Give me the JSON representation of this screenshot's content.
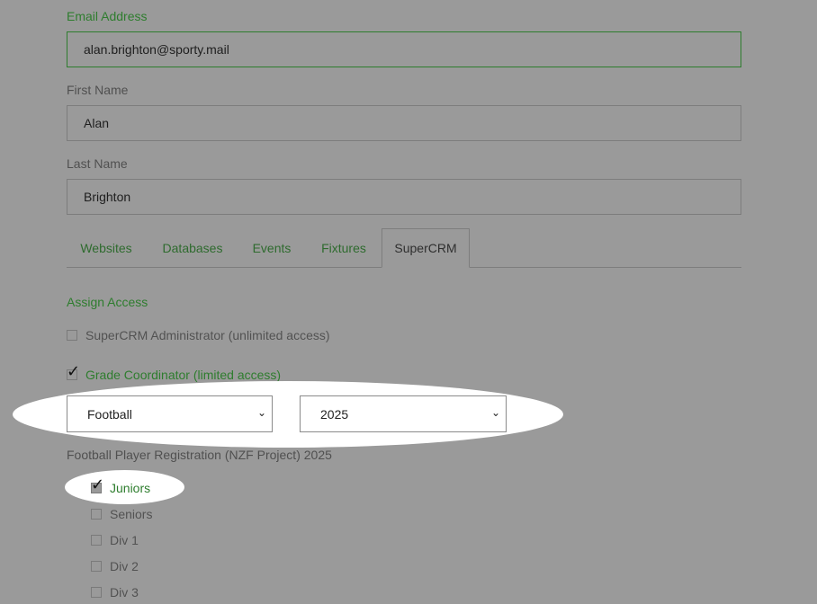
{
  "form": {
    "email": {
      "label": "Email Address",
      "value": "alan.brighton@sporty.mail"
    },
    "first_name": {
      "label": "First Name",
      "value": "Alan"
    },
    "last_name": {
      "label": "Last Name",
      "value": "Brighton"
    }
  },
  "tabs": [
    {
      "label": "Websites",
      "active": false
    },
    {
      "label": "Databases",
      "active": false
    },
    {
      "label": "Events",
      "active": false
    },
    {
      "label": "Fixtures",
      "active": false
    },
    {
      "label": "SuperCRM",
      "active": true
    }
  ],
  "access": {
    "heading": "Assign Access",
    "admin": {
      "label": "SuperCRM Administrator (unlimited access)",
      "checked": false
    },
    "coordinator": {
      "label": "Grade Coordinator (limited access)",
      "checked": true
    },
    "sport_select": {
      "value": "Football"
    },
    "year_select": {
      "value": "2025"
    },
    "project_title": "Football Player Registration (NZF Project) 2025",
    "grades": [
      {
        "label": "Juniors",
        "checked": true
      },
      {
        "label": "Seniors",
        "checked": false
      },
      {
        "label": "Div 1",
        "checked": false
      },
      {
        "label": "Div 2",
        "checked": false
      },
      {
        "label": "Div 3",
        "checked": false
      }
    ]
  },
  "colors": {
    "accent": "#2e7d2e",
    "overlay": "#9a9a9a",
    "highlight": "#ffffff"
  }
}
